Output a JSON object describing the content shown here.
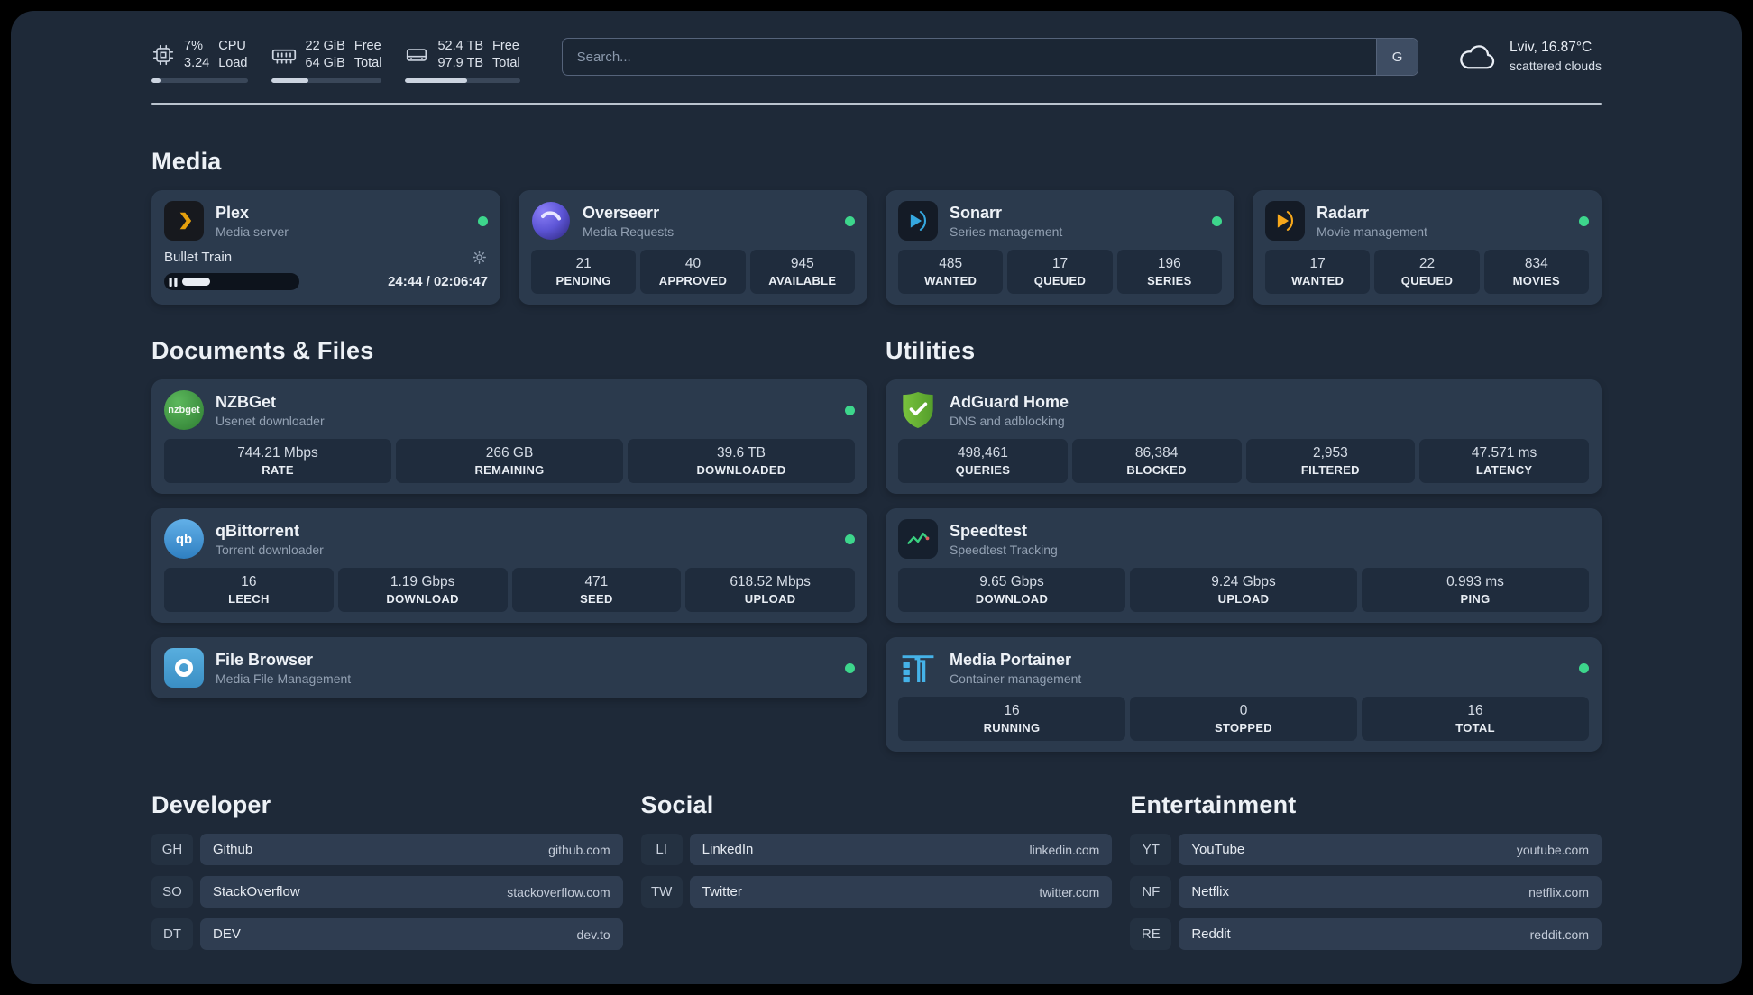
{
  "theme": {
    "background": "#000000",
    "panel": "#1e2938",
    "card": "#2b3a4d",
    "stat_box": "#1f2c3d",
    "status_online": "#3dd68c",
    "accent_plex": "#e5a00d",
    "accent_sonarr": "#35a8e0",
    "accent_radarr": "#f7a81b",
    "accent_adguard": "#68b43a",
    "accent_speedtest": "#3ad080",
    "accent_portainer": "#45b2e8"
  },
  "topbar": {
    "cpu": {
      "value_top": "7%",
      "value_bottom": "3.24",
      "label_top": "CPU",
      "label_bottom": "Load",
      "progress_pct": 9
    },
    "ram": {
      "value_top": "22 GiB",
      "value_bottom": "64 GiB",
      "label_top": "Free",
      "label_bottom": "Total",
      "progress_pct": 34
    },
    "disk": {
      "value_top": "52.4 TB",
      "value_bottom": "97.9 TB",
      "label_top": "Free",
      "label_bottom": "Total",
      "progress_pct": 54
    },
    "search": {
      "placeholder": "Search...",
      "engine_button": "G"
    },
    "weather": {
      "location": "Lviv, 16.87°C",
      "condition": "scattered clouds"
    }
  },
  "sections": {
    "media": "Media",
    "documents": "Documents & Files",
    "utilities": "Utilities",
    "developer": "Developer",
    "social": "Social",
    "entertainment": "Entertainment"
  },
  "services": {
    "plex": {
      "name": "Plex",
      "description": "Media server",
      "player": {
        "track": "Bullet Train",
        "time": "24:44 / 02:06:47",
        "progress_pct": 22
      }
    },
    "overseerr": {
      "name": "Overseerr",
      "description": "Media Requests",
      "stats": [
        {
          "value": "21",
          "label": "PENDING"
        },
        {
          "value": "40",
          "label": "APPROVED"
        },
        {
          "value": "945",
          "label": "AVAILABLE"
        }
      ]
    },
    "sonarr": {
      "name": "Sonarr",
      "description": "Series management",
      "stats": [
        {
          "value": "485",
          "label": "WANTED"
        },
        {
          "value": "17",
          "label": "QUEUED"
        },
        {
          "value": "196",
          "label": "SERIES"
        }
      ]
    },
    "radarr": {
      "name": "Radarr",
      "description": "Movie management",
      "stats": [
        {
          "value": "17",
          "label": "WANTED"
        },
        {
          "value": "22",
          "label": "QUEUED"
        },
        {
          "value": "834",
          "label": "MOVIES"
        }
      ]
    },
    "nzbget": {
      "name": "NZBGet",
      "description": "Usenet downloader",
      "icon_text": "nzbget",
      "stats": [
        {
          "value": "744.21 Mbps",
          "label": "RATE"
        },
        {
          "value": "266 GB",
          "label": "REMAINING"
        },
        {
          "value": "39.6 TB",
          "label": "DOWNLOADED"
        }
      ]
    },
    "qbittorrent": {
      "name": "qBittorrent",
      "description": "Torrent downloader",
      "icon_text": "qb",
      "stats": [
        {
          "value": "16",
          "label": "LEECH"
        },
        {
          "value": "1.19 Gbps",
          "label": "DOWNLOAD"
        },
        {
          "value": "471",
          "label": "SEED"
        },
        {
          "value": "618.52 Mbps",
          "label": "UPLOAD"
        }
      ]
    },
    "filebrowser": {
      "name": "File Browser",
      "description": "Media File Management"
    },
    "adguard": {
      "name": "AdGuard Home",
      "description": "DNS and adblocking",
      "stats": [
        {
          "value": "498,461",
          "label": "QUERIES"
        },
        {
          "value": "86,384",
          "label": "BLOCKED"
        },
        {
          "value": "2,953",
          "label": "FILTERED"
        },
        {
          "value": "47.571 ms",
          "label": "LATENCY"
        }
      ]
    },
    "speedtest": {
      "name": "Speedtest",
      "description": "Speedtest Tracking",
      "stats": [
        {
          "value": "9.65 Gbps",
          "label": "DOWNLOAD"
        },
        {
          "value": "9.24 Gbps",
          "label": "UPLOAD"
        },
        {
          "value": "0.993 ms",
          "label": "PING"
        }
      ]
    },
    "portainer": {
      "name": "Media Portainer",
      "description": "Container management",
      "stats": [
        {
          "value": "16",
          "label": "RUNNING"
        },
        {
          "value": "0",
          "label": "STOPPED"
        },
        {
          "value": "16",
          "label": "TOTAL"
        }
      ]
    }
  },
  "bookmarks": {
    "developer": [
      {
        "abbr": "GH",
        "name": "Github",
        "url": "github.com"
      },
      {
        "abbr": "SO",
        "name": "StackOverflow",
        "url": "stackoverflow.com"
      },
      {
        "abbr": "DT",
        "name": "DEV",
        "url": "dev.to"
      }
    ],
    "social": [
      {
        "abbr": "LI",
        "name": "LinkedIn",
        "url": "linkedin.com"
      },
      {
        "abbr": "TW",
        "name": "Twitter",
        "url": "twitter.com"
      }
    ],
    "entertainment": [
      {
        "abbr": "YT",
        "name": "YouTube",
        "url": "youtube.com"
      },
      {
        "abbr": "NF",
        "name": "Netflix",
        "url": "netflix.com"
      },
      {
        "abbr": "RE",
        "name": "Reddit",
        "url": "reddit.com"
      }
    ]
  }
}
